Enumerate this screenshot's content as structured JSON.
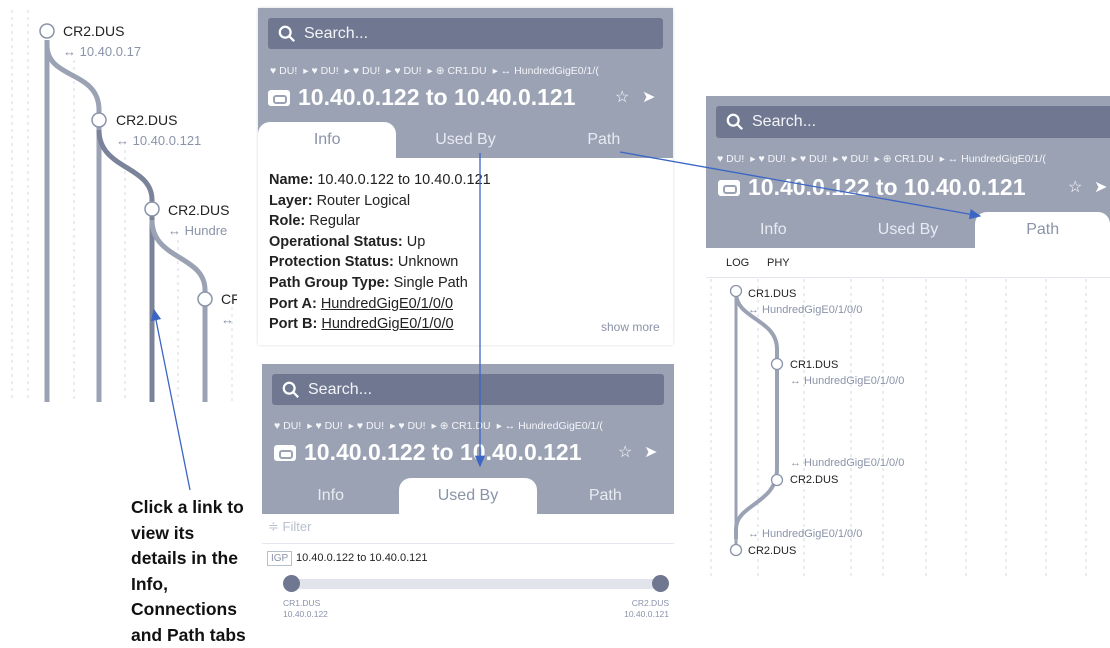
{
  "left_tree": {
    "nodes": [
      {
        "label": "CR2.DUS",
        "sub": "↔ 10.40.0.17"
      },
      {
        "label": "CR2.DUS",
        "sub": "↔ 10.40.0.121"
      },
      {
        "label": "CR2.DUS",
        "sub": "↔ Hundre"
      },
      {
        "label": "CF",
        "sub": "↔"
      }
    ]
  },
  "caption": {
    "lines": [
      "Click a link to",
      "view its",
      "details in the",
      "Info,",
      "Connections",
      "and Path tabs"
    ]
  },
  "panel_info": {
    "search_placeholder": "Search...",
    "crumbs": [
      "♥ DU!",
      "♥ DU!",
      "♥ DU!",
      "♥ DU!",
      "⊕ CR1.DU",
      "↔ HundredGigE0/1/("
    ],
    "title": "10.40.0.122 to 10.40.0.121",
    "tabs": [
      "Info",
      "Used By",
      "Path"
    ],
    "active_tab": "Info",
    "fields": {
      "name_label": "Name:",
      "name_value": "10.40.0.122 to 10.40.0.121",
      "layer_label": "Layer:",
      "layer_value": "Router Logical",
      "role_label": "Role:",
      "role_value": "Regular",
      "opstatus_label": "Operational Status:",
      "opstatus_value": "Up",
      "protstatus_label": "Protection Status:",
      "protstatus_value": "Unknown",
      "pgt_label": "Path Group Type:",
      "pgt_value": "Single Path",
      "porta_label": "Port A:",
      "porta_value": "HundredGigE0/1/0/0",
      "portb_label": "Port B:",
      "portb_value": "HundredGigE0/1/0/0"
    },
    "show_more": "show more"
  },
  "panel_usedby": {
    "search_placeholder": "Search...",
    "crumbs": [
      "♥ DU!",
      "♥ DU!",
      "♥ DU!",
      "♥ DU!",
      "⊕ CR1.DU",
      "↔ HundredGigE0/1/("
    ],
    "title": "10.40.0.122 to 10.40.0.121",
    "tabs": [
      "Info",
      "Used By",
      "Path"
    ],
    "active_tab": "Used By",
    "filter_placeholder": "Filter",
    "row": {
      "badge": "IGP",
      "label": "10.40.0.122 to 10.40.0.121",
      "a_name": "CR1.DUS",
      "a_ip": "10.40.0.122",
      "b_name": "CR2.DUS",
      "b_ip": "10.40.0.121"
    }
  },
  "panel_path": {
    "search_placeholder": "Search...",
    "crumbs": [
      "♥ DU!",
      "♥ DU!",
      "♥ DU!",
      "♥ DU!",
      "⊕ CR1.DU",
      "↔ HundredGigE0/1/("
    ],
    "title": "10.40.0.122 to 10.40.0.121",
    "tabs": [
      "Info",
      "Used By",
      "Path"
    ],
    "active_tab": "Path",
    "toggles": [
      "LOG",
      "PHY"
    ],
    "nodes": [
      {
        "label": "CR1.DUS",
        "sub": "↔ HundredGigE0/1/0/0"
      },
      {
        "label": "CR1.DUS",
        "sub": "↔ HundredGigE0/1/0/0"
      },
      {
        "label": "CR2.DUS",
        "sub": "↔ HundredGigE0/1/0/0"
      },
      {
        "label": "CR2.DUS",
        "sub": "↔ HundredGigE0/1/0/0"
      }
    ]
  },
  "colors": {
    "header": "#9aa2b4",
    "search": "#6f7890",
    "arrow": "#3b66c4",
    "tree_line": "#9aa2b4"
  }
}
